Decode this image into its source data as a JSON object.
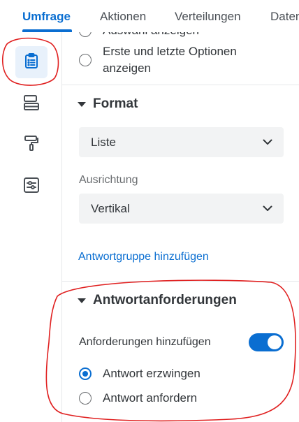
{
  "tabs": [
    {
      "label": "Umfrage",
      "active": true
    },
    {
      "label": "Aktionen",
      "active": false
    },
    {
      "label": "Verteilungen",
      "active": false
    },
    {
      "label": "Daten",
      "active": false
    }
  ],
  "rail": {
    "items": [
      {
        "icon": "clipboard-list-icon",
        "active": true
      },
      {
        "icon": "layout-blocks-icon",
        "active": false
      },
      {
        "icon": "paint-roller-icon",
        "active": false
      },
      {
        "icon": "settings-sliders-icon",
        "active": false
      }
    ]
  },
  "display_options": {
    "partial_option_label": "Auswahl anzeigen",
    "first_last_label": "Erste und letzte Optionen anzeigen"
  },
  "format_section": {
    "title": "Format",
    "format_value": "Liste",
    "orientation_label": "Ausrichtung",
    "orientation_value": "Vertikal",
    "add_group_link": "Antwortgruppe hinzufügen"
  },
  "requirements_section": {
    "title": "Antwortanforderungen",
    "toggle_label": "Anforderungen hinzufügen",
    "toggle_on": true,
    "options": [
      {
        "label": "Antwort erzwingen",
        "checked": true
      },
      {
        "label": "Antwort anfordern",
        "checked": false
      }
    ]
  },
  "colors": {
    "accent": "#0a6ed1",
    "annotation": "#e02020"
  }
}
